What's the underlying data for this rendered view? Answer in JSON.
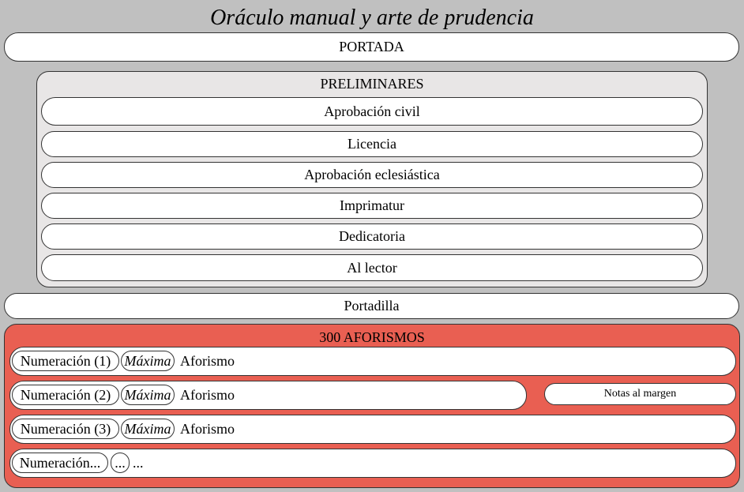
{
  "title": "Oráculo manual y arte de prudencia",
  "portada": "PORTADA",
  "preliminares": {
    "label": "PRELIMINARES",
    "items": [
      "Aprobación civil",
      "Licencia",
      "Aprobación eclesiástica",
      "Imprimatur",
      "Dedicatoria",
      "Al lector"
    ]
  },
  "portadilla": "Portadilla",
  "aforismos": {
    "label": "300 AFORISMOS",
    "rows": [
      {
        "num": "Numeración (1)",
        "maxima": "Máxima",
        "text": "Aforismo"
      },
      {
        "num": "Numeración (2)",
        "maxima": "Máxima",
        "text": "Aforismo"
      },
      {
        "num": "Numeración (3)",
        "maxima": "Máxima",
        "text": "Aforismo"
      },
      {
        "num": "Numeración...",
        "maxima": "...",
        "text": "..."
      }
    ],
    "notas": "Notas al margen"
  },
  "colors": {
    "background": "#c0c0c0",
    "preliminares_bg": "#e8e6e6",
    "aforismos_bg": "#e95f52",
    "node_bg": "#ffffff"
  }
}
